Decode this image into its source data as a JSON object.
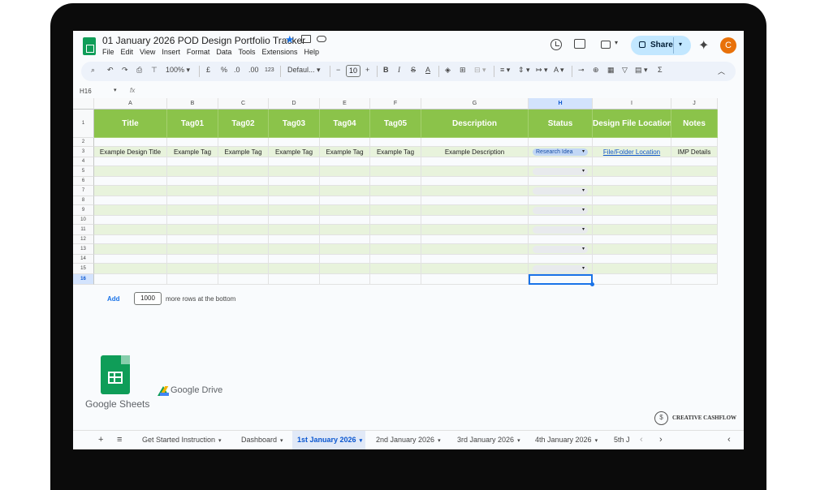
{
  "titlebar": {
    "doc_title": "01 January 2026 POD Design Portfolio Tracker",
    "menu": [
      "File",
      "Edit",
      "View",
      "Insert",
      "Format",
      "Data",
      "Tools",
      "Extensions",
      "Help"
    ],
    "share_label": "Share",
    "avatar_letter": "C"
  },
  "toolbar": {
    "zoom": "100%",
    "currency": "£",
    "percent": "%",
    "dec_decrease": ".0",
    "dec_increase": ".00",
    "number_format": "123",
    "font": "Defaul...",
    "font_size": "10",
    "bold": "B",
    "italic": "I"
  },
  "formula_bar": {
    "name_box": "H16",
    "fx": "fx"
  },
  "columns": [
    "A",
    "B",
    "C",
    "D",
    "E",
    "F",
    "G",
    "H",
    "I",
    "J"
  ],
  "selected_column": "H",
  "rows": [
    "1",
    "2",
    "3",
    "4",
    "5",
    "6",
    "7",
    "8",
    "9",
    "10",
    "11",
    "12",
    "13",
    "14",
    "15",
    "16"
  ],
  "selected_row": "16",
  "header_row": [
    "Title",
    "Tag01",
    "Tag02",
    "Tag03",
    "Tag04",
    "Tag05",
    "Description",
    "Status",
    "Design File Location",
    "Notes"
  ],
  "example_row": [
    "Example Design Title",
    "Example Tag",
    "Example Tag",
    "Example Tag",
    "Example Tag",
    "Example Tag",
    "Example Description",
    "Research Idea",
    "File/Folder Location",
    "IMP Details"
  ],
  "add_rows": {
    "button": "Add",
    "count": "1000",
    "label": "more rows at the bottom"
  },
  "logos": {
    "sheets": "Google Sheets",
    "drive": "Google Drive",
    "creator": "CREATIVE CASHFLOW"
  },
  "tabs": [
    "Get Started Instruction",
    "Dashboard",
    "1st January 2026",
    "2nd January 2026",
    "3rd January 2026",
    "4th January 2026",
    "5th J"
  ],
  "active_tab": "1st January 2026",
  "colors": {
    "header_green": "#8bc34a",
    "band_green": "#e8f3dc",
    "chip_blue": "#c2d7f5",
    "share_blue": "#c2e7ff",
    "avatar_orange": "#e8710a"
  }
}
